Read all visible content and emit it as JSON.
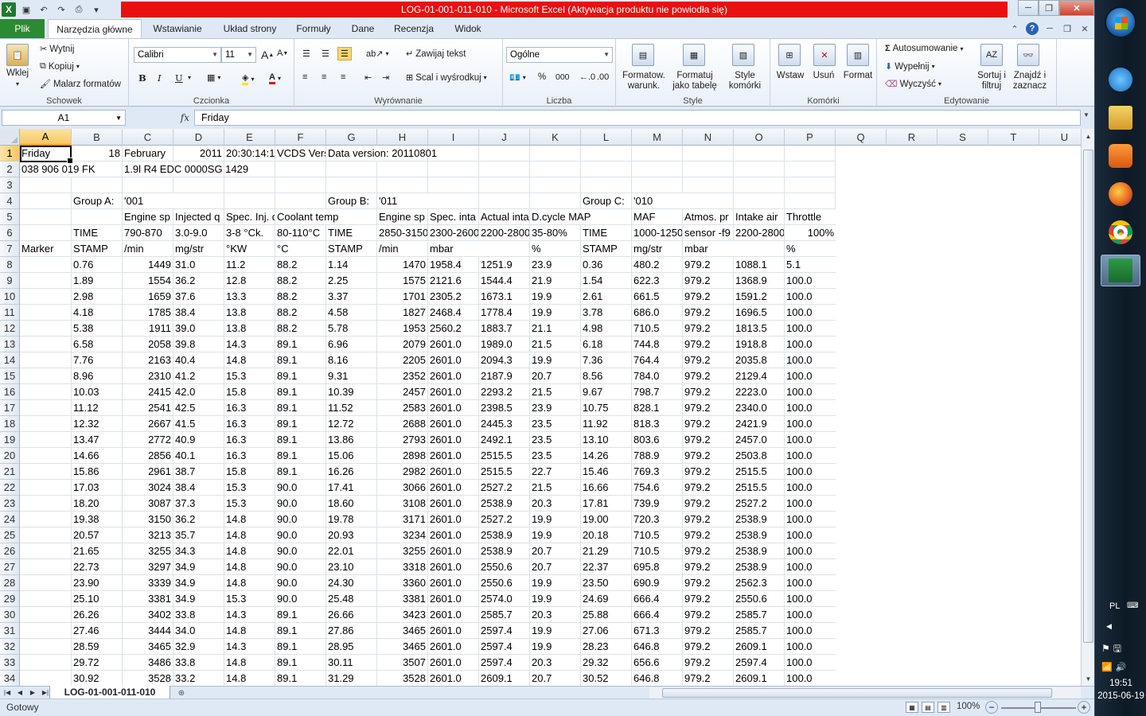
{
  "window": {
    "title": "LOG-01-001-011-010  -  Microsoft Excel (Aktywacja produktu nie powiodła się)",
    "app_icon": "X"
  },
  "ribbon_tabs": {
    "file": "Plik",
    "home": "Narzędzia główne",
    "insert": "Wstawianie",
    "layout": "Układ strony",
    "formulas": "Formuły",
    "data": "Dane",
    "review": "Recenzja",
    "view": "Widok"
  },
  "clipboard": {
    "paste": "Wklej",
    "cut": "Wytnij",
    "copy": "Kopiuj",
    "painter": "Malarz formatów",
    "label": "Schowek"
  },
  "font_group": {
    "font_name": "Calibri",
    "font_size": "11",
    "bold": "B",
    "italic": "I",
    "underline": "U",
    "label": "Czcionka"
  },
  "alignment": {
    "wrap": "Zawijaj tekst",
    "merge": "Scal i wyśrodkuj",
    "label": "Wyrównanie"
  },
  "number": {
    "format": "Ogólne",
    "percent": "%",
    "thousands": "000",
    "label": "Liczba"
  },
  "styles": {
    "cond_format": "Formatow. warunk.",
    "as_table": "Formatuj jako tabelę",
    "cell_styles": "Style komórki",
    "label": "Style"
  },
  "cells_group": {
    "insert": "Wstaw",
    "delete": "Usuń",
    "format": "Format",
    "label": "Komórki"
  },
  "editing": {
    "autosum": "Autosumowanie",
    "fill": "Wypełnij",
    "clear": "Wyczyść",
    "sort": "Sortuj i filtruj",
    "find": "Znajdź i zaznacz",
    "label": "Edytowanie"
  },
  "formula_bar": {
    "name_box": "A1",
    "fx": "fx",
    "content": "Friday"
  },
  "columns": [
    "A",
    "B",
    "C",
    "D",
    "E",
    "F",
    "G",
    "H",
    "I",
    "J",
    "K",
    "L",
    "M",
    "N",
    "O",
    "P",
    "Q",
    "R",
    "S",
    "T",
    "U"
  ],
  "row_numbers": [
    "1",
    "2",
    "3",
    "4",
    "5",
    "6",
    "7",
    "8",
    "9",
    "10",
    "11",
    "12",
    "13",
    "14",
    "15",
    "16",
    "17",
    "18",
    "19",
    "20",
    "21",
    "22",
    "23",
    "24",
    "25",
    "26",
    "27",
    "28",
    "29",
    "30",
    "31",
    "32",
    "33",
    "34"
  ],
  "header_rows": [
    [
      "Friday",
      "18",
      "February",
      "2011",
      "20:30:14:1",
      "VCDS Vers",
      "Data version: 20110801",
      "",
      "",
      "",
      "",
      "",
      "",
      "",
      "",
      ""
    ],
    [
      "038 906 019 FK",
      "",
      "1.9l R4 EDC 0000SG  1429",
      "",
      "",
      "",
      "",
      "",
      "",
      "",
      "",
      "",
      "",
      "",
      "",
      ""
    ],
    [
      "",
      "",
      "",
      "",
      "",
      "",
      "",
      "",
      "",
      "",
      "",
      "",
      "",
      "",
      "",
      ""
    ],
    [
      "",
      "Group A:",
      "'001",
      "",
      "",
      "",
      "Group B:",
      "'011",
      "",
      "",
      "",
      "Group C:",
      "'010",
      "",
      "",
      ""
    ],
    [
      "",
      "",
      "Engine sp",
      "Injected q",
      "Spec. Inj. q",
      "Coolant temp",
      "",
      "Engine sp",
      "Spec. inta",
      "Actual inta",
      "D.cycle MAP",
      "",
      "MAF",
      "Atmos. pr",
      "Intake air",
      "Throttle"
    ],
    [
      "",
      "TIME",
      "790-870",
      "3.0-9.0",
      "3-8 °Ck.",
      "80-110°C",
      "TIME",
      "2850-3150",
      "2300-2600",
      "2200-2800",
      "35-80%",
      "TIME",
      "1000-1250",
      "sensor -f9",
      "2200-2800",
      "100%"
    ],
    [
      "Marker",
      "STAMP",
      "/min",
      "mg/str",
      "°KW",
      "°C",
      "STAMP",
      "/min",
      "mbar",
      "",
      "%",
      "STAMP",
      "mg/str",
      "mbar",
      "",
      " %"
    ]
  ],
  "data_rows": [
    [
      "",
      "0.76",
      "1449",
      "31.0",
      "11.2",
      "88.2",
      "1.14",
      "1470",
      "1958.4",
      "1251.9",
      "23.9",
      "0.36",
      "480.2",
      "979.2",
      "1088.1",
      "5.1"
    ],
    [
      "",
      "1.89",
      "1554",
      "36.2",
      "12.8",
      "88.2",
      "2.25",
      "1575",
      "2121.6",
      "1544.4",
      "21.9",
      "1.54",
      "622.3",
      "979.2",
      "1368.9",
      "100.0"
    ],
    [
      "",
      "2.98",
      "1659",
      "37.6",
      "13.3",
      "88.2",
      "3.37",
      "1701",
      "2305.2",
      "1673.1",
      "19.9",
      "2.61",
      "661.5",
      "979.2",
      "1591.2",
      "100.0"
    ],
    [
      "",
      "4.18",
      "1785",
      "38.4",
      "13.8",
      "88.2",
      "4.58",
      "1827",
      "2468.4",
      "1778.4",
      "19.9",
      "3.78",
      "686.0",
      "979.2",
      "1696.5",
      "100.0"
    ],
    [
      "",
      "5.38",
      "1911",
      "39.0",
      "13.8",
      "88.2",
      "5.78",
      "1953",
      "2560.2",
      "1883.7",
      "21.1",
      "4.98",
      "710.5",
      "979.2",
      "1813.5",
      "100.0"
    ],
    [
      "",
      "6.58",
      "2058",
      "39.8",
      "14.3",
      "89.1",
      "6.96",
      "2079",
      "2601.0",
      "1989.0",
      "21.5",
      "6.18",
      "744.8",
      "979.2",
      "1918.8",
      "100.0"
    ],
    [
      "",
      "7.76",
      "2163",
      "40.4",
      "14.8",
      "89.1",
      "8.16",
      "2205",
      "2601.0",
      "2094.3",
      "19.9",
      "7.36",
      "764.4",
      "979.2",
      "2035.8",
      "100.0"
    ],
    [
      "",
      "8.96",
      "2310",
      "41.2",
      "15.3",
      "89.1",
      "9.31",
      "2352",
      "2601.0",
      "2187.9",
      "20.7",
      "8.56",
      "784.0",
      "979.2",
      "2129.4",
      "100.0"
    ],
    [
      "",
      "10.03",
      "2415",
      "42.0",
      "15.8",
      "89.1",
      "10.39",
      "2457",
      "2601.0",
      "2293.2",
      "21.5",
      "9.67",
      "798.7",
      "979.2",
      "2223.0",
      "100.0"
    ],
    [
      "",
      "11.12",
      "2541",
      "42.5",
      "16.3",
      "89.1",
      "11.52",
      "2583",
      "2601.0",
      "2398.5",
      "23.9",
      "10.75",
      "828.1",
      "979.2",
      "2340.0",
      "100.0"
    ],
    [
      "",
      "12.32",
      "2667",
      "41.5",
      "16.3",
      "89.1",
      "12.72",
      "2688",
      "2601.0",
      "2445.3",
      "23.5",
      "11.92",
      "818.3",
      "979.2",
      "2421.9",
      "100.0"
    ],
    [
      "",
      "13.47",
      "2772",
      "40.9",
      "16.3",
      "89.1",
      "13.86",
      "2793",
      "2601.0",
      "2492.1",
      "23.5",
      "13.10",
      "803.6",
      "979.2",
      "2457.0",
      "100.0"
    ],
    [
      "",
      "14.66",
      "2856",
      "40.1",
      "16.3",
      "89.1",
      "15.06",
      "2898",
      "2601.0",
      "2515.5",
      "23.5",
      "14.26",
      "788.9",
      "979.2",
      "2503.8",
      "100.0"
    ],
    [
      "",
      "15.86",
      "2961",
      "38.7",
      "15.8",
      "89.1",
      "16.26",
      "2982",
      "2601.0",
      "2515.5",
      "22.7",
      "15.46",
      "769.3",
      "979.2",
      "2515.5",
      "100.0"
    ],
    [
      "",
      "17.03",
      "3024",
      "38.4",
      "15.3",
      "90.0",
      "17.41",
      "3066",
      "2601.0",
      "2527.2",
      "21.5",
      "16.66",
      "754.6",
      "979.2",
      "2515.5",
      "100.0"
    ],
    [
      "",
      "18.20",
      "3087",
      "37.3",
      "15.3",
      "90.0",
      "18.60",
      "3108",
      "2601.0",
      "2538.9",
      "20.3",
      "17.81",
      "739.9",
      "979.2",
      "2527.2",
      "100.0"
    ],
    [
      "",
      "19.38",
      "3150",
      "36.2",
      "14.8",
      "90.0",
      "19.78",
      "3171",
      "2601.0",
      "2527.2",
      "19.9",
      "19.00",
      "720.3",
      "979.2",
      "2538.9",
      "100.0"
    ],
    [
      "",
      "20.57",
      "3213",
      "35.7",
      "14.8",
      "90.0",
      "20.93",
      "3234",
      "2601.0",
      "2538.9",
      "19.9",
      "20.18",
      "710.5",
      "979.2",
      "2538.9",
      "100.0"
    ],
    [
      "",
      "21.65",
      "3255",
      "34.3",
      "14.8",
      "90.0",
      "22.01",
      "3255",
      "2601.0",
      "2538.9",
      "20.7",
      "21.29",
      "710.5",
      "979.2",
      "2538.9",
      "100.0"
    ],
    [
      "",
      "22.73",
      "3297",
      "34.9",
      "14.8",
      "90.0",
      "23.10",
      "3318",
      "2601.0",
      "2550.6",
      "20.7",
      "22.37",
      "695.8",
      "979.2",
      "2538.9",
      "100.0"
    ],
    [
      "",
      "23.90",
      "3339",
      "34.9",
      "14.8",
      "90.0",
      "24.30",
      "3360",
      "2601.0",
      "2550.6",
      "19.9",
      "23.50",
      "690.9",
      "979.2",
      "2562.3",
      "100.0"
    ],
    [
      "",
      "25.10",
      "3381",
      "34.9",
      "15.3",
      "90.0",
      "25.48",
      "3381",
      "2601.0",
      "2574.0",
      "19.9",
      "24.69",
      "666.4",
      "979.2",
      "2550.6",
      "100.0"
    ],
    [
      "",
      "26.26",
      "3402",
      "33.8",
      "14.3",
      "89.1",
      "26.66",
      "3423",
      "2601.0",
      "2585.7",
      "20.3",
      "25.88",
      "666.4",
      "979.2",
      "2585.7",
      "100.0"
    ],
    [
      "",
      "27.46",
      "3444",
      "34.0",
      "14.8",
      "89.1",
      "27.86",
      "3465",
      "2601.0",
      "2597.4",
      "19.9",
      "27.06",
      "671.3",
      "979.2",
      "2585.7",
      "100.0"
    ],
    [
      "",
      "28.59",
      "3465",
      "32.9",
      "14.3",
      "89.1",
      "28.95",
      "3465",
      "2601.0",
      "2597.4",
      "19.9",
      "28.23",
      "646.8",
      "979.2",
      "2609.1",
      "100.0"
    ],
    [
      "",
      "29.72",
      "3486",
      "33.8",
      "14.8",
      "89.1",
      "30.11",
      "3507",
      "2601.0",
      "2597.4",
      "20.3",
      "29.32",
      "656.6",
      "979.2",
      "2597.4",
      "100.0"
    ],
    [
      "",
      "30.92",
      "3528",
      "33.2",
      "14.8",
      "89.1",
      "31.29",
      "3528",
      "2601.0",
      "2609.1",
      "20.7",
      "30.52",
      "646.8",
      "979.2",
      "2609.1",
      "100.0"
    ]
  ],
  "sheet_tab": "LOG-01-001-011-010",
  "status": {
    "ready": "Gotowy",
    "zoom": "100%"
  },
  "taskbar": {
    "lang": "PL",
    "time": "19:51",
    "date": "2015-06-19"
  },
  "colors": {
    "title_red": "#e81010",
    "file_tab_green": "#2c8a32",
    "selected_header": "#f5c860"
  }
}
